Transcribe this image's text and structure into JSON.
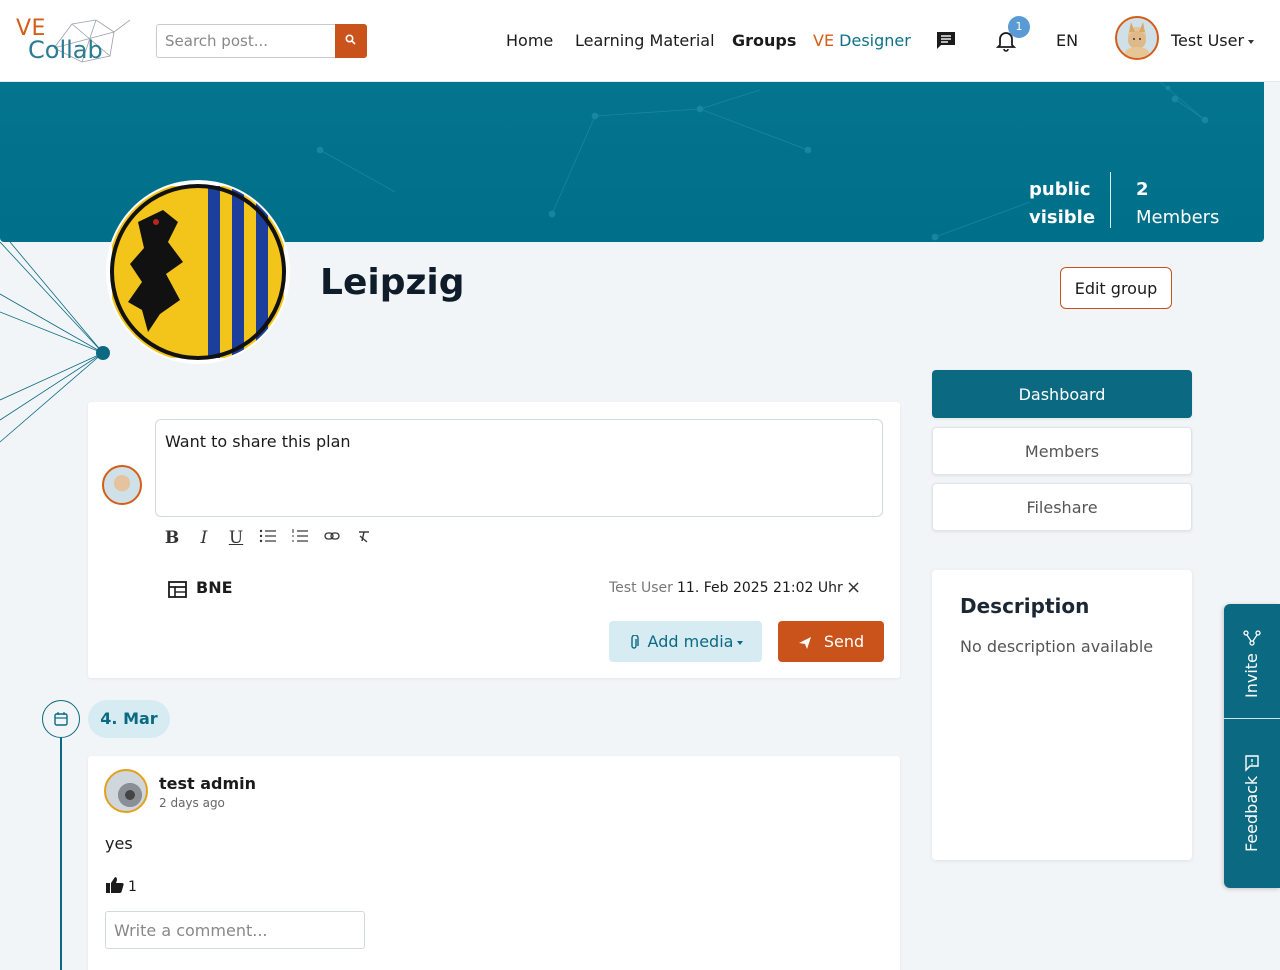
{
  "header": {
    "logo_ve": "VE",
    "logo_collab": "Collab",
    "search_placeholder": "Search post...",
    "nav": {
      "home": "Home",
      "learning": "Learning Material",
      "groups": "Groups",
      "designer_prefix": "VE",
      "designer_rest": "Designer"
    },
    "notification_count": "1",
    "language": "EN",
    "user_name": "Test User"
  },
  "banner": {
    "visibility_line1": "public",
    "visibility_line2": "visible",
    "member_count": "2",
    "member_label": "Members"
  },
  "group": {
    "title": "Leipzig",
    "edit_label": "Edit group"
  },
  "menu": {
    "items": [
      {
        "label": "Dashboard",
        "active": true
      },
      {
        "label": "Members",
        "active": false
      },
      {
        "label": "Fileshare",
        "active": false
      }
    ]
  },
  "description": {
    "title": "Description",
    "text": "No description available"
  },
  "composer": {
    "text": "Want to share this plan",
    "plan_name": "BNE",
    "plan_author": "Test User",
    "plan_date": "11. Feb 2025 21:02 Uhr",
    "close_symbol": "×",
    "add_media_label": "Add media",
    "send_label": "Send"
  },
  "timeline": {
    "date": "4. Mar"
  },
  "post": {
    "author": "test admin",
    "time": "2 days ago",
    "body": "yes",
    "likes": "1",
    "comment_placeholder": "Write a comment..."
  },
  "side_tab": {
    "invite_label": "Invite",
    "feedback_label": "Feedback"
  },
  "colors": {
    "primary": "#0b6a82",
    "accent": "#c9531a",
    "banner": "#04758f",
    "light_primary": "#d6ecf2"
  }
}
